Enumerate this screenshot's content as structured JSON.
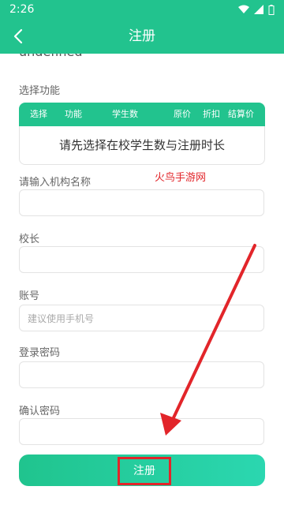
{
  "status_bar": {
    "time": "2:26"
  },
  "app_bar": {
    "title": "注册"
  },
  "clipped_text": "undefined",
  "select_section": {
    "label": "选择功能",
    "columns": [
      "选择",
      "功能",
      "学生数",
      "原价",
      "折扣",
      "结算价"
    ],
    "empty_message": "请先选择在校学生数与注册时长"
  },
  "watermark": "火鸟手游网",
  "form": {
    "org_name_label": "请输入机构名称",
    "org_name_value": "",
    "principal_label": "校长",
    "principal_value": "",
    "account_label": "账号",
    "account_placeholder": "建议使用手机号",
    "password_label": "登录密码",
    "password_value": "",
    "confirm_label": "确认密码",
    "confirm_value": ""
  },
  "register_button": {
    "label": "注册"
  },
  "colors": {
    "brand": "#22c38e",
    "highlight": "#e2252a"
  }
}
